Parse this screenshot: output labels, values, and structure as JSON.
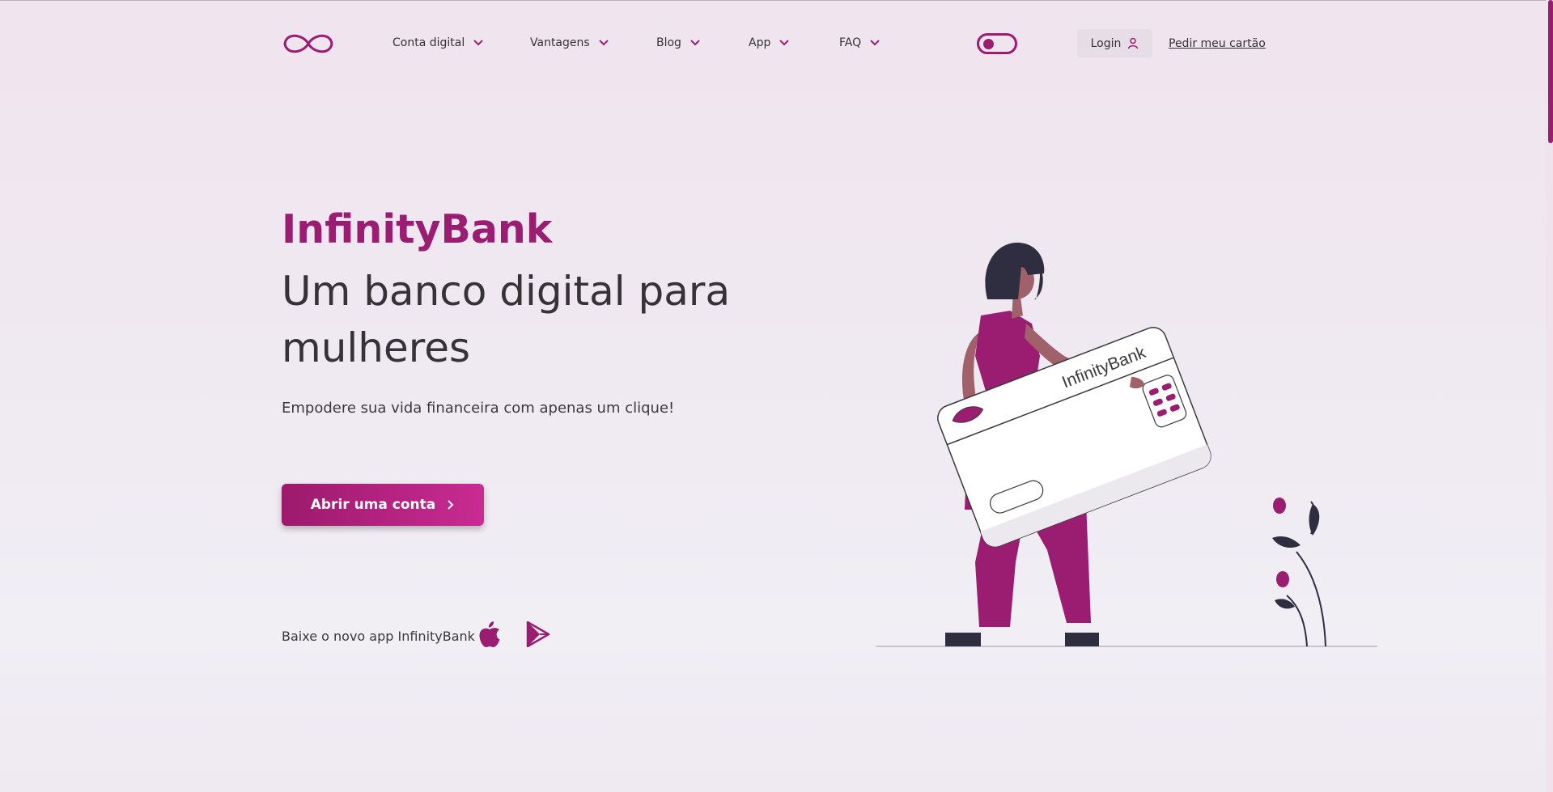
{
  "header": {
    "logo_icon": "infinity-logo-icon",
    "nav": [
      {
        "label": "Conta digital"
      },
      {
        "label": "Vantagens"
      },
      {
        "label": "Blog"
      },
      {
        "label": "App"
      },
      {
        "label": "FAQ"
      }
    ],
    "theme_toggle_icon": "toggle-icon",
    "login_label": "Login",
    "login_icon": "user-icon",
    "cta_link": "Pedir meu cartão"
  },
  "hero": {
    "brand": "InfinityBank",
    "headline": "Um banco digital para mulheres",
    "subtitle": "Empodere sua vida financeira com apenas um clique!",
    "button_label": "Abrir uma conta",
    "download_label": "Baixe o novo app InfinityBank",
    "store_icons": [
      "apple-icon",
      "google-play-icon"
    ]
  },
  "illustration": {
    "card_label": "InfinityBank"
  },
  "colors": {
    "accent": "#9a1d72",
    "accent_light": "#c92b92",
    "text": "#363236"
  }
}
